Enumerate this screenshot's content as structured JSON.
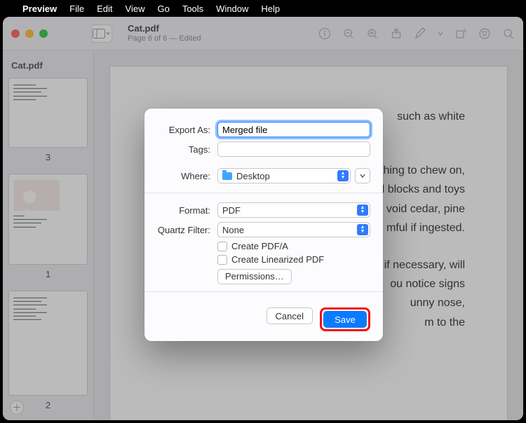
{
  "menubar": {
    "app": "Preview",
    "items": [
      "File",
      "Edit",
      "View",
      "Go",
      "Tools",
      "Window",
      "Help"
    ]
  },
  "window": {
    "doc_name": "Cat.pdf",
    "doc_subtitle": "Page 6 of 6  —  Edited"
  },
  "sidebar": {
    "title": "Cat.pdf",
    "pages": [
      "3",
      "1",
      "2"
    ]
  },
  "doc_text": {
    "l1": "such as white",
    "l2": "thing to chew on,",
    "l3": "d blocks and toys",
    "l4": "void cedar, pine",
    "l5": "mful if ingested.",
    "l6": "g if necessary, will",
    "l7": "ou notice signs",
    "l8": "unny nose,",
    "l9": "m to the"
  },
  "dialog": {
    "export_as_label": "Export As:",
    "export_as_value": "Merged file",
    "tags_label": "Tags:",
    "tags_value": "",
    "where_label": "Where:",
    "where_value": "Desktop",
    "format_label": "Format:",
    "format_value": "PDF",
    "quartz_label": "Quartz Filter:",
    "quartz_value": "None",
    "cb1": "Create PDF/A",
    "cb2": "Create Linearized PDF",
    "permissions": "Permissions…",
    "cancel": "Cancel",
    "save": "Save"
  }
}
